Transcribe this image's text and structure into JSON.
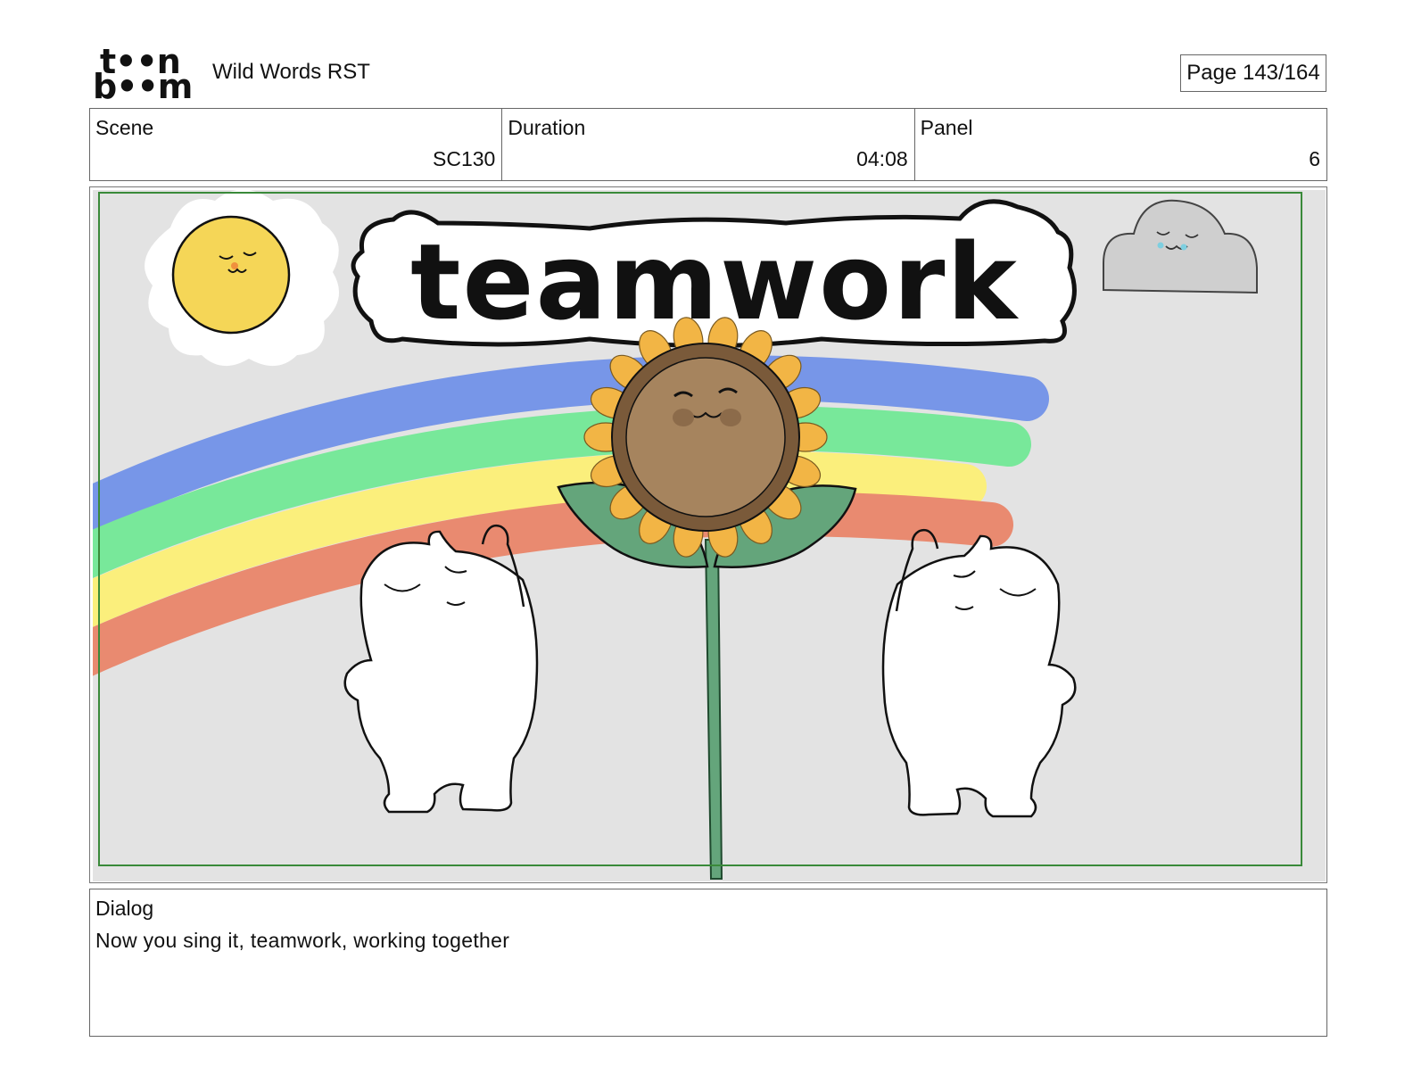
{
  "header": {
    "logo_line1": "t••n",
    "logo_line2": "b••m",
    "project_title": "Wild Words RST",
    "page": "Page 143/164"
  },
  "info": {
    "scene_label": "Scene",
    "scene_value": "SC130",
    "duration_label": "Duration",
    "duration_value": "04:08",
    "panel_label": "Panel",
    "panel_value": "6"
  },
  "panel_image": {
    "title_text": "teamwork",
    "colors": {
      "background": "#e3e3e3",
      "safe_frame": "#3a8a3a",
      "rainbow": [
        "#7796e8",
        "#78e89a",
        "#fbef7c",
        "#e98a70"
      ],
      "sun": "#f5d657",
      "cloud": "#cfcfcf",
      "petals": "#f2b545",
      "flower_face": "#a6845e",
      "flower_rim": "#7a5a3a",
      "leaf": "#64a57b"
    }
  },
  "dialog": {
    "label": "Dialog",
    "text": "Now you sing it, teamwork, working together"
  }
}
